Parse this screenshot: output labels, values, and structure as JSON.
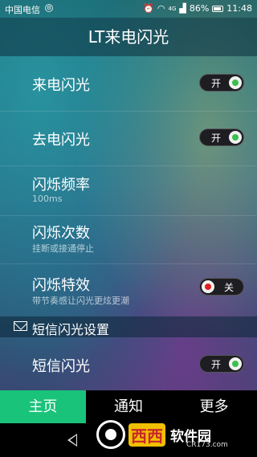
{
  "status": {
    "carrier": "中国电信",
    "battery": "86%",
    "time": "11:48",
    "net": "4G",
    "alarm_icon": "alarm-icon",
    "wifi_icon": "wifi-icon",
    "signal_icon": "signal-icon"
  },
  "title": "LT来电闪光",
  "rows": [
    {
      "label": "来电闪光",
      "switch": "开"
    },
    {
      "label": "去电闪光",
      "switch": "开"
    },
    {
      "label": "闪烁频率",
      "sub": "100ms"
    },
    {
      "label": "闪烁次数",
      "sub": "挂断或接通停止"
    },
    {
      "label": "闪烁特效",
      "sub": "带节奏感让闪光更炫更潮",
      "switch": "关"
    },
    {
      "label": "短信闪光",
      "switch": "开"
    }
  ],
  "section": {
    "title": "短信闪光设置"
  },
  "nav": {
    "tabs": [
      "主页",
      "通知",
      "更多"
    ]
  },
  "watermark": {
    "a": "西西",
    "b": "软件园",
    "c": "CR173.com"
  },
  "colors": {
    "accent": "#19c37a",
    "on_dot": "#3bbf4f",
    "off_dot": "#e02020"
  }
}
